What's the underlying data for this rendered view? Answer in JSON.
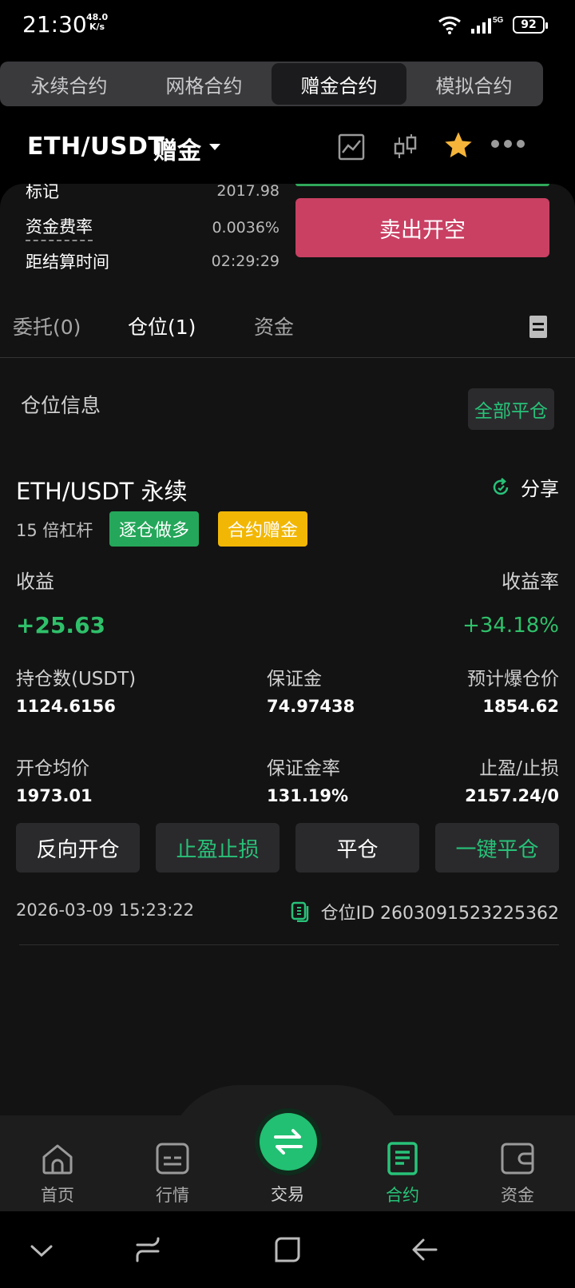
{
  "status_bar": {
    "time": "21:30",
    "net_speed_value": "48.0",
    "net_speed_unit": "K/s",
    "network": "5G",
    "battery": "92"
  },
  "contract_tabs": [
    {
      "label": "永续合约",
      "active": false
    },
    {
      "label": "网格合约",
      "active": false
    },
    {
      "label": "赠金合约",
      "active": true
    },
    {
      "label": "模拟合约",
      "active": false
    }
  ],
  "header": {
    "pair": "ETH/USDT",
    "mode": "赠金"
  },
  "market_info": [
    {
      "label": "标记",
      "value": "2017.98"
    },
    {
      "label": "资金费率",
      "value": "0.0036%"
    },
    {
      "label": "距结算时间",
      "value": "02:29:29"
    }
  ],
  "sell_button": "卖出开空",
  "sub_tabs": [
    {
      "label": "委托(0)",
      "active": false
    },
    {
      "label": "仓位(1)",
      "active": true
    },
    {
      "label": "资金",
      "active": false
    }
  ],
  "position_section": {
    "title": "仓位信息",
    "close_all": "全部平仓"
  },
  "position": {
    "name": "ETH/USDT 永续",
    "share": "分享",
    "leverage": "15 倍杠杆",
    "badge_1": "逐仓做多",
    "badge_2": "合约赠金",
    "pnl_label": "收益",
    "pnl_rate_label": "收益率",
    "pnl": "+25.63",
    "pnl_rate": "+34.18%",
    "size_label": "持仓数(USDT)",
    "size": "1124.6156",
    "margin_label": "保证金",
    "margin": "74.97438",
    "liq_label": "预计爆仓价",
    "liq": "1854.62",
    "entry_label": "开仓均价",
    "entry": "1973.01",
    "margin_ratio_label": "保证金率",
    "margin_ratio": "131.19%",
    "tpsl_label": "止盈/止损",
    "tpsl": "2157.24/0",
    "actions": [
      "反向开仓",
      "止盈止损",
      "平仓",
      "一键平仓"
    ],
    "date": "2026-03-09 15:23:22",
    "position_id": "仓位ID 2603091523225362"
  },
  "bottom_nav": [
    {
      "label": "首页",
      "icon": "home-icon",
      "active": false
    },
    {
      "label": "行情",
      "icon": "market-icon",
      "active": false
    },
    {
      "label": "交易",
      "icon": "swap-icon",
      "active": false
    },
    {
      "label": "合约",
      "icon": "contract-icon",
      "active": true
    },
    {
      "label": "资金",
      "icon": "wallet-icon",
      "active": false
    }
  ],
  "colors": {
    "green": "#28c279",
    "sell": "#c94063",
    "yellow": "#f2b705",
    "bg": "#131313"
  }
}
